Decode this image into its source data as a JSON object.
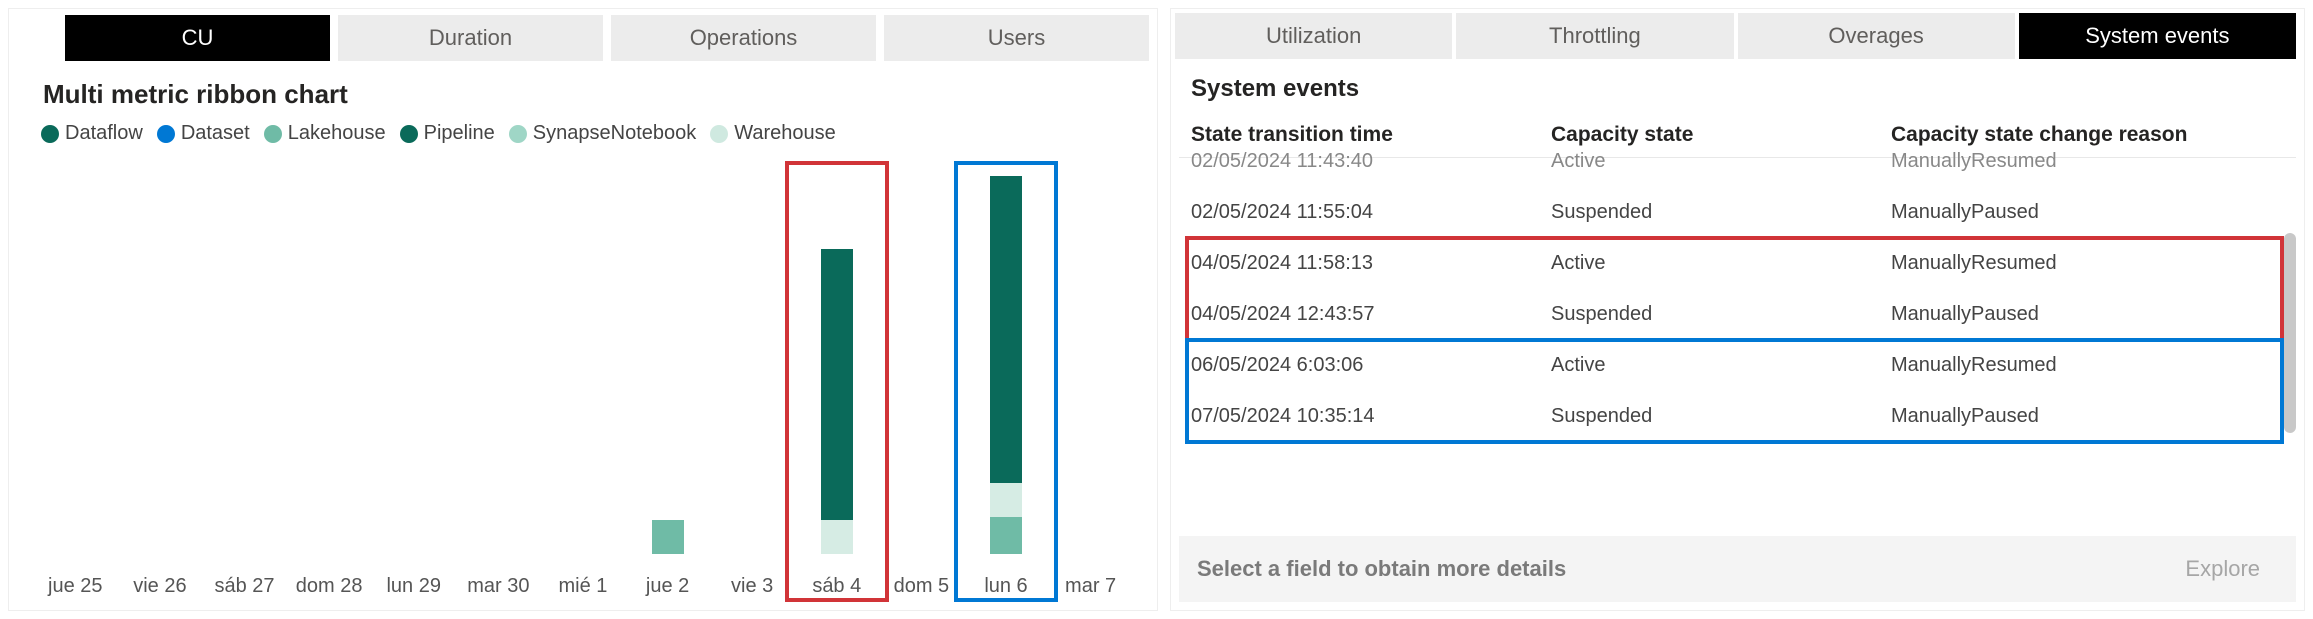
{
  "left_tabs": [
    "CU",
    "Duration",
    "Operations",
    "Users"
  ],
  "left_active_tab": 0,
  "right_tabs": [
    "Utilization",
    "Throttling",
    "Overages",
    "System events"
  ],
  "right_active_tab": 3,
  "chart": {
    "title": "Multi metric ribbon chart",
    "legend": [
      {
        "name": "Dataflow",
        "color": "#0a6a5a"
      },
      {
        "name": "Dataset",
        "color": "#0078d4"
      },
      {
        "name": "Lakehouse",
        "color": "#6fbba6"
      },
      {
        "name": "Pipeline",
        "color": "#0a6a5a"
      },
      {
        "name": "SynapseNotebook",
        "color": "#9fd6c6"
      },
      {
        "name": "Warehouse",
        "color": "#cfe9e0"
      }
    ]
  },
  "chart_data": {
    "type": "bar",
    "categories": [
      "jue 25",
      "vie 26",
      "sáb 27",
      "dom 28",
      "lun 29",
      "mar 30",
      "mié 1",
      "jue 2",
      "vie 3",
      "sáb 4",
      "dom 5",
      "lun 6",
      "mar 7"
    ],
    "series": [
      {
        "name": "Lakehouse",
        "color": "#6fbba6",
        "values": [
          0,
          0,
          0,
          0,
          0,
          0,
          0,
          28,
          0,
          0,
          0,
          30,
          0
        ]
      },
      {
        "name": "Warehouse",
        "color": "#d6ece4",
        "values": [
          0,
          0,
          0,
          0,
          0,
          0,
          0,
          0,
          0,
          28,
          0,
          28,
          0
        ]
      },
      {
        "name": "Dataflow",
        "color": "#0a6a5a",
        "values": [
          0,
          0,
          0,
          0,
          0,
          0,
          0,
          0,
          0,
          220,
          0,
          250,
          0
        ]
      }
    ],
    "ylim": [
      0,
      320
    ],
    "highlights": [
      {
        "category": "sáb 4",
        "color": "#d13438"
      },
      {
        "category": "lun 6",
        "color": "#0078d4"
      }
    ]
  },
  "events": {
    "title": "System events",
    "columns": [
      "State transition time",
      "Capacity state",
      "Capacity state change reason"
    ],
    "rows": [
      {
        "time": "02/05/2024 11:43:40",
        "state": "Active",
        "reason": "ManuallyResumed",
        "cut": true
      },
      {
        "time": "02/05/2024 11:55:04",
        "state": "Suspended",
        "reason": "ManuallyPaused"
      },
      {
        "time": "04/05/2024 11:58:13",
        "state": "Active",
        "reason": "ManuallyResumed"
      },
      {
        "time": "04/05/2024 12:43:57",
        "state": "Suspended",
        "reason": "ManuallyPaused"
      },
      {
        "time": "06/05/2024 6:03:06",
        "state": "Active",
        "reason": "ManuallyResumed"
      },
      {
        "time": "07/05/2024 10:35:14",
        "state": "Suspended",
        "reason": "ManuallyPaused"
      }
    ],
    "row_highlights": [
      {
        "start": 2,
        "end": 3,
        "color": "#d13438"
      },
      {
        "start": 4,
        "end": 5,
        "color": "#0078d4"
      }
    ]
  },
  "footer": {
    "hint": "Select a field to obtain more details",
    "button": "Explore"
  }
}
